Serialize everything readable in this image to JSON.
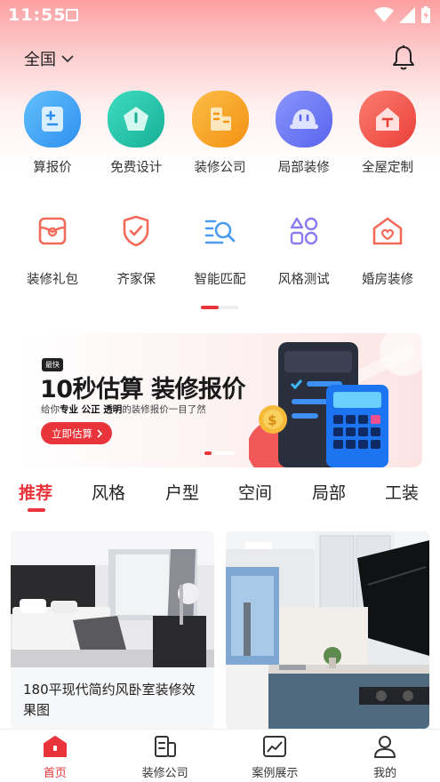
{
  "status_bar": {
    "time": "11:55"
  },
  "header": {
    "location": "全国"
  },
  "top_grid": [
    {
      "label": "算报价",
      "icon": "calculator-icon",
      "color": "#3ca3f5"
    },
    {
      "label": "免费设计",
      "icon": "design-icon",
      "color": "#21c3a8"
    },
    {
      "label": "装修公司",
      "icon": "company-icon",
      "color": "#f6a320"
    },
    {
      "label": "局部装修",
      "icon": "helmet-icon",
      "color": "#6b78f3"
    },
    {
      "label": "全屋定制",
      "icon": "house-icon",
      "color": "#f25a52"
    }
  ],
  "second_grid": [
    {
      "label": "装修礼包",
      "icon": "gift-icon",
      "color": "#f26a5a"
    },
    {
      "label": "齐家保",
      "icon": "shield-icon",
      "color": "#f26a5a"
    },
    {
      "label": "智能匹配",
      "icon": "match-search-icon",
      "color": "#4b9cf0"
    },
    {
      "label": "风格测试",
      "icon": "shapes-icon",
      "color": "#8a7cf0"
    },
    {
      "label": "婚房装修",
      "icon": "heart-house-icon",
      "color": "#f26a5a"
    }
  ],
  "banner": {
    "tag": "最快",
    "title": "10秒估算 装修报价",
    "subtitle_prefix": "给你",
    "subtitle_bold": "专业 公正 透明",
    "subtitle_suffix": "的装修报价一目了然",
    "button_label": "立即估算"
  },
  "tabs": [
    "推荐",
    "风格",
    "户型",
    "空间",
    "局部",
    "工装"
  ],
  "cards": [
    {
      "title": "180平现代简约风卧室装修效果图"
    },
    {
      "title": ""
    }
  ],
  "bottom_nav": [
    {
      "label": "首页",
      "icon": "home-icon"
    },
    {
      "label": "装修公司",
      "icon": "company-doc-icon"
    },
    {
      "label": "案例展示",
      "icon": "gallery-icon"
    },
    {
      "label": "我的",
      "icon": "user-icon"
    }
  ],
  "colors": {
    "accent": "#e8343a"
  }
}
